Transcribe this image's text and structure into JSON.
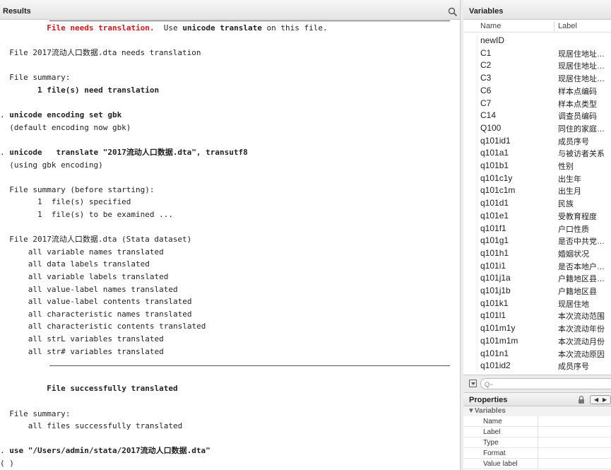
{
  "results": {
    "title": "Results",
    "search_icon": "magnifier-icon",
    "lines": [
      [
        {
          "t": "          "
        },
        {
          "t": "File needs translation.",
          "c": "red"
        },
        {
          "t": "  Use "
        },
        {
          "t": "unicode translate",
          "c": "b"
        },
        {
          "t": " on this file."
        }
      ],
      [],
      [
        {
          "t": "  File 2017流动人口数据.dta needs translation"
        }
      ],
      [],
      [
        {
          "t": "  File summary:"
        }
      ],
      [
        {
          "t": "        "
        },
        {
          "t": "1 file(s) need translation",
          "c": "b"
        }
      ],
      [],
      [
        {
          "t": ". "
        },
        {
          "t": "unicode encoding set gbk",
          "c": "b"
        }
      ],
      [
        {
          "t": "  (default encoding now gbk)"
        }
      ],
      [],
      [
        {
          "t": ". "
        },
        {
          "t": "unicode   translate \"2017流动人口数据.dta\", transutf8",
          "c": "b"
        }
      ],
      [
        {
          "t": "  (using gbk encoding)"
        }
      ],
      [],
      [
        {
          "t": "  File summary (before starting):"
        }
      ],
      [
        {
          "t": "        1  file(s) specified"
        }
      ],
      [
        {
          "t": "        1  file(s) to be examined ..."
        }
      ],
      [],
      [
        {
          "t": "  File 2017流动人口数据.dta (Stata dataset)"
        }
      ],
      [
        {
          "t": "      all variable names translated"
        }
      ],
      [
        {
          "t": "      all data labels translated"
        }
      ],
      [
        {
          "t": "      all variable labels translated"
        }
      ],
      [
        {
          "t": "      all value-label names translated"
        }
      ],
      [
        {
          "t": "      all value-label contents translated"
        }
      ],
      [
        {
          "t": "      all characteristic names translated"
        }
      ],
      [
        {
          "t": "      all characteristic contents translated"
        }
      ],
      [
        {
          "t": "      all strL variables translated"
        }
      ],
      [
        {
          "t": "      all str# variables translated"
        }
      ],
      [],
      [],
      [
        {
          "t": "          "
        },
        {
          "t": "File successfully translated",
          "c": "b"
        }
      ],
      [],
      [
        {
          "t": "  File summary:"
        }
      ],
      [
        {
          "t": "      all files successfully translated"
        }
      ],
      [],
      [
        {
          "t": ". "
        },
        {
          "t": "use \"/Users/admin/stata/2017流动人口数据.dta\"",
          "c": "b"
        }
      ],
      [
        {
          "t": "( )"
        }
      ]
    ]
  },
  "variables": {
    "title": "Variables",
    "col_name": "Name",
    "col_label": "Label",
    "rows": [
      {
        "name": "newID",
        "label": ""
      },
      {
        "name": "C1",
        "label": "现居住地址…"
      },
      {
        "name": "C2",
        "label": "现居住地址…"
      },
      {
        "name": "C3",
        "label": "现居住地址…"
      },
      {
        "name": "C6",
        "label": "样本点编码"
      },
      {
        "name": "C7",
        "label": "样本点类型"
      },
      {
        "name": "C14",
        "label": "调查员编码"
      },
      {
        "name": "Q100",
        "label": "同住的家庭…"
      },
      {
        "name": "q101id1",
        "label": "成员序号"
      },
      {
        "name": "q101a1",
        "label": "与被访者关系"
      },
      {
        "name": "q101b1",
        "label": "性别"
      },
      {
        "name": "q101c1y",
        "label": "出生年"
      },
      {
        "name": "q101c1m",
        "label": "出生月"
      },
      {
        "name": "q101d1",
        "label": "民族"
      },
      {
        "name": "q101e1",
        "label": "受教育程度"
      },
      {
        "name": "q101f1",
        "label": "户口性质"
      },
      {
        "name": "q101g1",
        "label": "是否中共党…"
      },
      {
        "name": "q101h1",
        "label": "婚姻状况"
      },
      {
        "name": "q101i1",
        "label": "是否本地户…"
      },
      {
        "name": "q101j1a",
        "label": "户籍地区县…"
      },
      {
        "name": "q101j1b",
        "label": "户籍地区县"
      },
      {
        "name": "q101k1",
        "label": "现居住地"
      },
      {
        "name": "q101l1",
        "label": "本次流动范围"
      },
      {
        "name": "q101m1y",
        "label": "本次流动年份"
      },
      {
        "name": "q101m1m",
        "label": "本次流动月份"
      },
      {
        "name": "q101n1",
        "label": "本次流动原因"
      },
      {
        "name": "q101id2",
        "label": "成员序号"
      }
    ],
    "filter_placeholder": "Q~",
    "filter_icon": "filter-funnel-icon"
  },
  "properties": {
    "title": "Properties",
    "lock_icon": "lock-icon",
    "nav_prev": "◀",
    "nav_next": "▶",
    "section": "▼Variables",
    "rows": [
      "Name",
      "Label",
      "Type",
      "Format",
      "Value label"
    ]
  }
}
